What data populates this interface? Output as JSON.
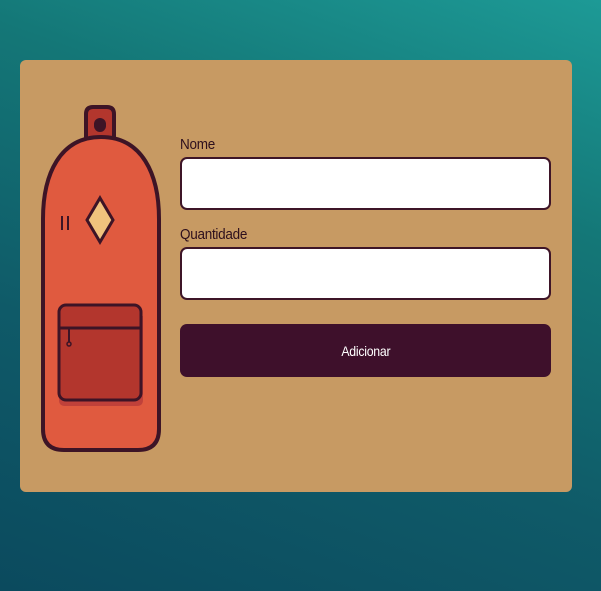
{
  "form": {
    "name_label": "Nome",
    "name_value": "",
    "quantity_label": "Quantidade",
    "quantity_value": "",
    "submit_label": "Adicionar"
  },
  "illustration": {
    "icon": "backpack-icon"
  },
  "colors": {
    "card": "#c79a63",
    "button": "#3e102b",
    "backpack": "#e05a3f",
    "pocket": "#b3362d",
    "outline": "#3d1426"
  }
}
